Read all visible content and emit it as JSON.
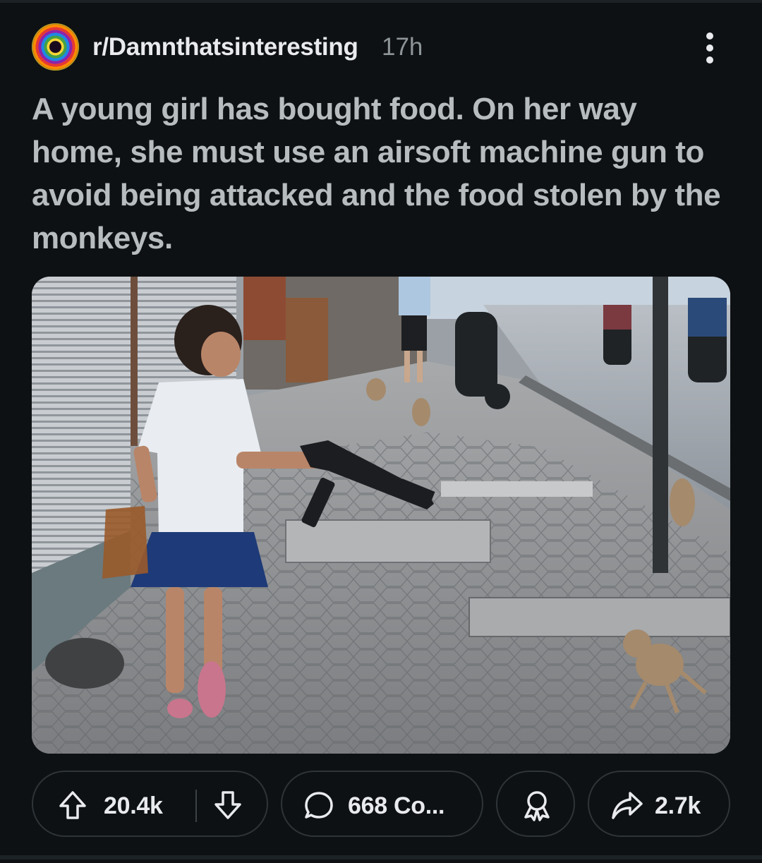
{
  "post": {
    "subreddit": "r/Damnthatsinteresting",
    "age": "17h",
    "title": "A young girl has bought food. On her way home, she must use an airsoft machine gun to avoid being attacked and the food stolen by the monkeys."
  },
  "actions": {
    "upvotes": "20.4k",
    "comments": "668 Co...",
    "shares": "2.7k"
  },
  "icons": {
    "avatar": "subreddit-avatar",
    "more": "more-vertical-icon",
    "upvote": "upvote-arrow-icon",
    "downvote": "downvote-arrow-icon",
    "comment": "comment-bubble-icon",
    "award": "award-icon",
    "share": "share-arrow-icon"
  },
  "colors": {
    "background": "#0e1113",
    "title": "#b7bcbf",
    "meta": "#8d9599",
    "pill_border": "#2e3438"
  }
}
